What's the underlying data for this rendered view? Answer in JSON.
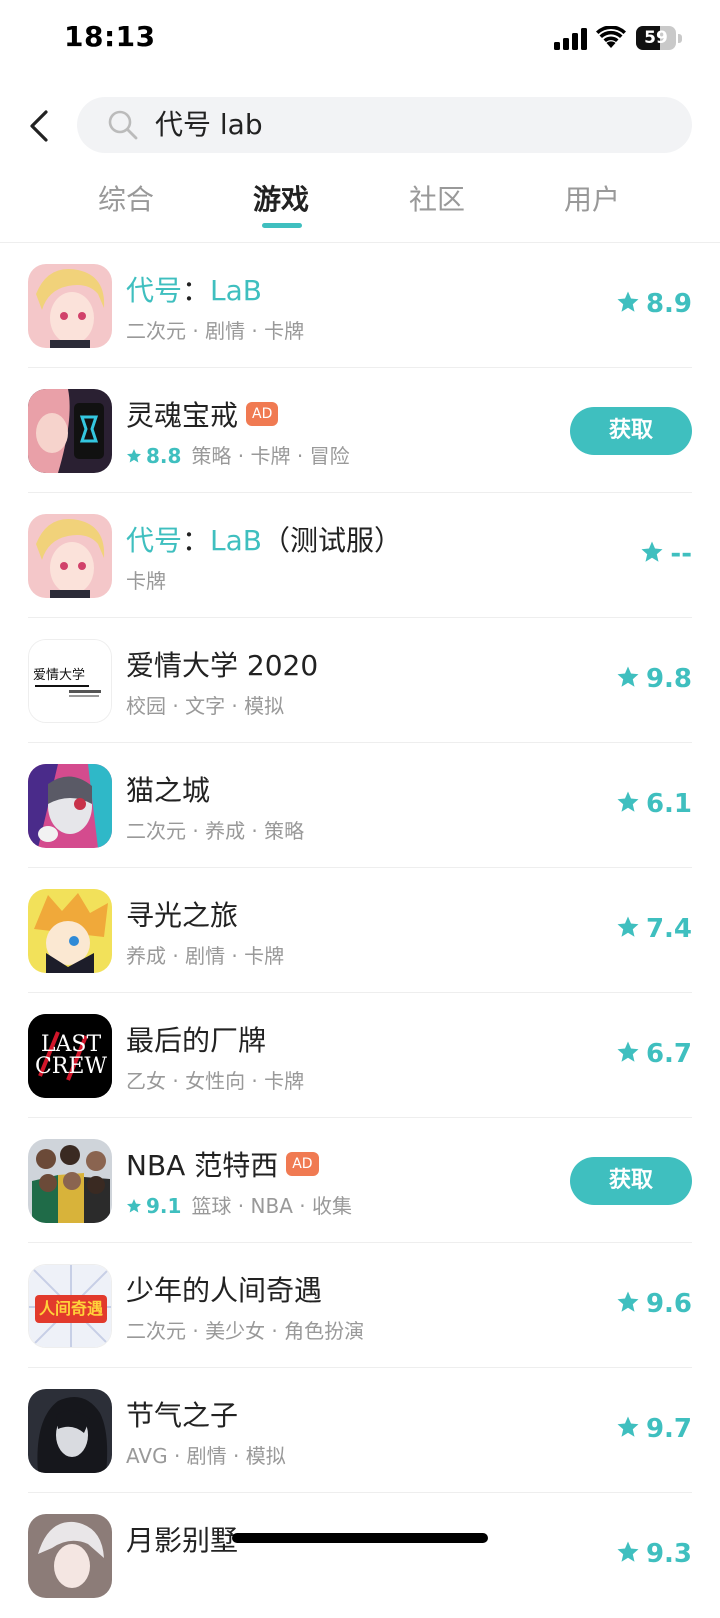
{
  "status_bar": {
    "time": "18:13",
    "battery_level": "59"
  },
  "search": {
    "query": "代号 lab"
  },
  "tabs": [
    {
      "label": "综合",
      "active": false
    },
    {
      "label": "游戏",
      "active": true
    },
    {
      "label": "社区",
      "active": false
    },
    {
      "label": "用户",
      "active": false
    }
  ],
  "accent_color": "#3fbfbf",
  "ad_color": "#f07a52",
  "games": [
    {
      "title_hl": "代号",
      "title_hl2": "LaB",
      "title_rest": "",
      "tags": "二次元 · 剧情 · 卡牌",
      "rating": "8.9"
    },
    {
      "title": "灵魂宝戒",
      "ad": "AD",
      "inline_rating": "8.8",
      "tags": "策略 · 卡牌 · 冒险",
      "button": "获取"
    },
    {
      "title_hl": "代号",
      "title_hl2": "LaB",
      "title_rest": "（测试服）",
      "tags": "卡牌",
      "rating": "--"
    },
    {
      "title": "爱情大学 2020",
      "tags": "校园 · 文字 · 模拟",
      "rating": "9.8",
      "icon_text": "爱情大学"
    },
    {
      "title": "猫之城",
      "tags": "二次元 · 养成 · 策略",
      "rating": "6.1"
    },
    {
      "title": "寻光之旅",
      "tags": "养成 · 剧情 · 卡牌",
      "rating": "7.4"
    },
    {
      "title": "最后的厂牌",
      "tags": "乙女 · 女性向 · 卡牌",
      "rating": "6.7",
      "icon_text": "LAST CREW"
    },
    {
      "title": "NBA 范特西",
      "ad": "AD",
      "inline_rating": "9.1",
      "tags": "篮球 · NBA · 收集",
      "button": "获取"
    },
    {
      "title": "少年的人间奇遇",
      "tags": "二次元 · 美少女 · 角色扮演",
      "rating": "9.6",
      "icon_text": "人间奇遇"
    },
    {
      "title": "节气之子",
      "tags": "AVG · 剧情 · 模拟",
      "rating": "9.7"
    },
    {
      "title": "月影别墅",
      "tags": "",
      "rating": "9.3"
    }
  ]
}
